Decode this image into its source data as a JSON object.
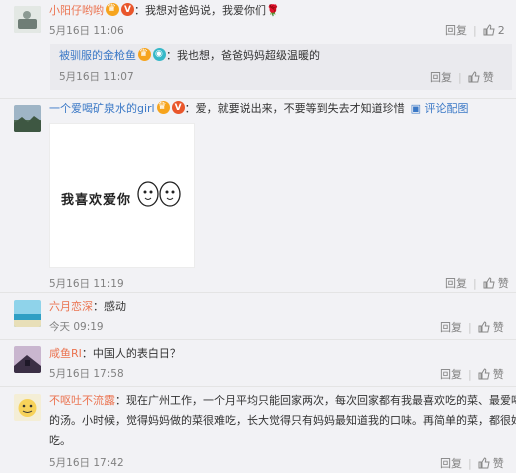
{
  "comments": [
    {
      "name": "小阳仔哟哟",
      "text": "：我想对爸妈说，我爱你们",
      "emoji": "🌹",
      "time": "5月16日 11:06",
      "reply_label": "回复",
      "like_count": "2",
      "sub": {
        "name": "被驯服的金枪鱼",
        "text": "：我也想，爸爸妈妈超级温暖的",
        "time": "5月16日 11:07",
        "reply_label": "回复",
        "like_label": "赞"
      }
    },
    {
      "name": "一个爱喝矿泉水的girl",
      "text": "：爱，就要说出来，不要等到失去才知道珍惜",
      "pic_link": "评论配图",
      "image_caption": "我喜欢爱你",
      "time": "5月16日 11:19",
      "reply_label": "回复",
      "like_label": "赞"
    },
    {
      "name": "六月恋深",
      "text": "：感动",
      "time": "今天 09:19",
      "reply_label": "回复",
      "like_label": "赞"
    },
    {
      "name": "咸鱼RI",
      "text": "：中国人的表白日？",
      "time": "5月16日 17:58",
      "reply_label": "回复",
      "like_label": "赞"
    },
    {
      "name": "不呕吐不流露",
      "text_line1": "：现在广州工作，一个月平均只能回家两次，每次回家都有我最喜欢吃的菜、最爱喝",
      "text_line2": "的汤。小时候，觉得妈妈做的菜很难吃，长大觉得只有妈妈最知道我的口味。再简单的菜，都很好",
      "text_line3": "吃。",
      "time": "5月16日 17:42",
      "reply_label": "回复",
      "like_label": "赞"
    }
  ],
  "colors": {
    "name_orange": "#eb7350",
    "name_blue": "#3a78c6",
    "muted": "#808080",
    "background": "#f2f2f5"
  }
}
